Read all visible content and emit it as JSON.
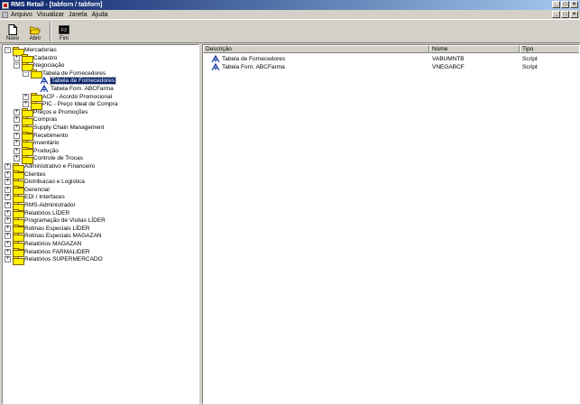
{
  "window": {
    "title": "RMS Retail - [tabforn / tabforn]",
    "minimize": "_",
    "maximize": "□",
    "close": "×"
  },
  "menu": [
    {
      "label": "Arquivo"
    },
    {
      "label": "Visualizar"
    },
    {
      "label": "Janela"
    },
    {
      "label": "Ajuda"
    }
  ],
  "toolbar": {
    "novo_label": "Novo",
    "abrir_label": "Abrir",
    "fim_label": "Fim",
    "fim_key": "F3"
  },
  "tree": [
    {
      "label": "Mercadorias",
      "level": 0,
      "exp": "−",
      "icon": "folder"
    },
    {
      "label": "Cadastro",
      "level": 1,
      "exp": "+",
      "icon": "folder"
    },
    {
      "label": "Negociação",
      "level": 1,
      "exp": "−",
      "icon": "folder"
    },
    {
      "label": "Tabela de Fornecedores",
      "level": 2,
      "exp": "−",
      "icon": "folder"
    },
    {
      "label": "Tabela de Fornecedores",
      "level": 3,
      "exp": "",
      "icon": "script",
      "selected": true
    },
    {
      "label": "Tabela Forn. ABCFarma",
      "level": 3,
      "exp": "",
      "icon": "script"
    },
    {
      "label": "ACP - Acordo Promocional",
      "level": 2,
      "exp": "+",
      "icon": "folder"
    },
    {
      "label": "PIC - Preço Ideal de Compra",
      "level": 2,
      "exp": "+",
      "icon": "folder"
    },
    {
      "label": "Preços e Promoções",
      "level": 1,
      "exp": "+",
      "icon": "folder"
    },
    {
      "label": "Compras",
      "level": 1,
      "exp": "+",
      "icon": "folder"
    },
    {
      "label": "Supply Chain Management",
      "level": 1,
      "exp": "+",
      "icon": "folder"
    },
    {
      "label": "Recebimento",
      "level": 1,
      "exp": "+",
      "icon": "folder"
    },
    {
      "label": "Inventário",
      "level": 1,
      "exp": "+",
      "icon": "folder"
    },
    {
      "label": "Produção",
      "level": 1,
      "exp": "+",
      "icon": "folder"
    },
    {
      "label": "Controle de Trocas",
      "level": 1,
      "exp": "+",
      "icon": "folder"
    },
    {
      "label": "Administrativo e Financeiro",
      "level": 0,
      "exp": "+",
      "icon": "folder"
    },
    {
      "label": "Clientes",
      "level": 0,
      "exp": "+",
      "icon": "folder"
    },
    {
      "label": "Distribuicao e Logistica",
      "level": 0,
      "exp": "+",
      "icon": "folder"
    },
    {
      "label": "Gerencial",
      "level": 0,
      "exp": "+",
      "icon": "folder"
    },
    {
      "label": "EDI / Interfaces",
      "level": 0,
      "exp": "+",
      "icon": "folder"
    },
    {
      "label": "RMS-Administrador",
      "level": 0,
      "exp": "+",
      "icon": "folder"
    },
    {
      "label": "Relatórios LÍDER",
      "level": 0,
      "exp": "+",
      "icon": "folder"
    },
    {
      "label": "Programação de Visitas LÍDER",
      "level": 0,
      "exp": "+",
      "icon": "folder"
    },
    {
      "label": "Rotinas Especiais LÍDER",
      "level": 0,
      "exp": "+",
      "icon": "folder"
    },
    {
      "label": "Rotinas Especiais MAGAZAN",
      "level": 0,
      "exp": "+",
      "icon": "folder"
    },
    {
      "label": "Relatórios MAGAZAN",
      "level": 0,
      "exp": "+",
      "icon": "folder"
    },
    {
      "label": "Relatórios FARMALIDER",
      "level": 0,
      "exp": "+",
      "icon": "folder"
    },
    {
      "label": "Relatórios SUPERMERCADO",
      "level": 0,
      "exp": "+",
      "icon": "folder"
    }
  ],
  "list": {
    "columns": [
      "Descrição",
      "Nome",
      "Tipo"
    ],
    "rows": [
      {
        "descricao": "Tabela de Fornecedores",
        "nome": "VABUMNTB",
        "tipo": "Script"
      },
      {
        "descricao": "Tabela Forn. ABCFarma",
        "nome": "VNEGABCF",
        "tipo": "Script"
      }
    ]
  },
  "colors": {
    "title_start": "#0a246a",
    "title_end": "#a6caf0",
    "selection": "#0a246a",
    "folder": "#ffef00",
    "chrome": "#d4d0c8"
  }
}
